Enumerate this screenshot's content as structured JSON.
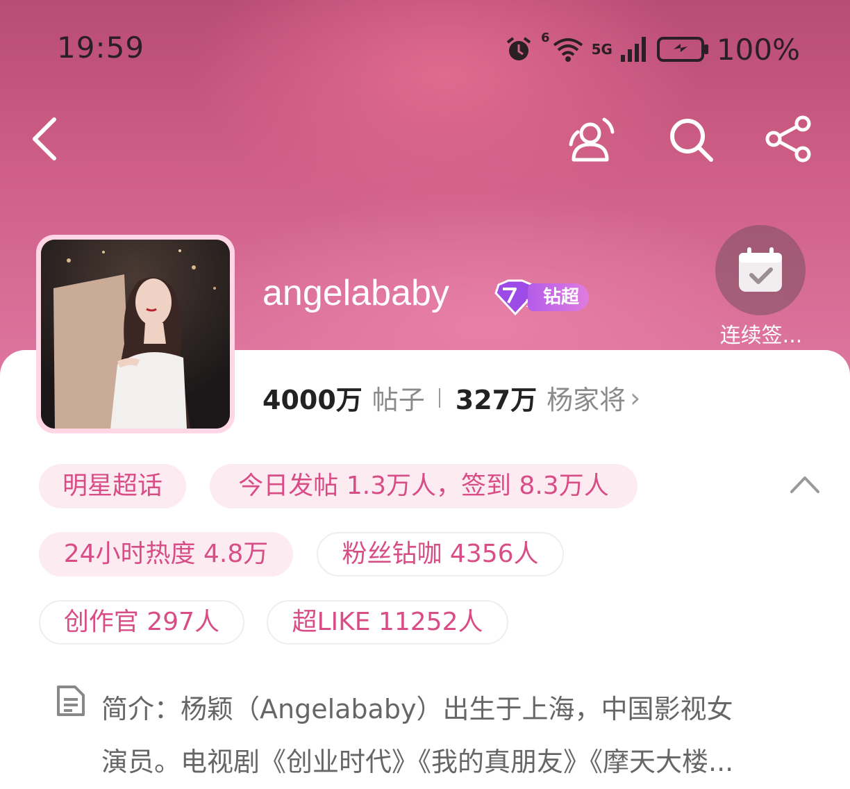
{
  "status_bar": {
    "time": "19:59",
    "network": "5G",
    "signal_label": "6",
    "battery": "100%"
  },
  "nav": {
    "back_icon": "chevron-left-icon",
    "icons": [
      "members-icon",
      "search-icon",
      "share-icon"
    ]
  },
  "profile": {
    "name": "angelababy",
    "badge_label": "钻超",
    "checkin_label": "连续签..."
  },
  "stats": {
    "posts_count": "4000万",
    "posts_label": "帖子",
    "fans_count": "327万",
    "fans_label": "杨家将",
    "chevron": "›"
  },
  "tags": [
    {
      "label": "明星超话"
    },
    {
      "label": "今日发帖 1.3万人，签到 8.3万人"
    },
    {
      "label": "24小时热度 4.8万"
    },
    {
      "label": "粉丝钻咖 4356人"
    },
    {
      "label": "创作官 297人"
    },
    {
      "label": "超LIKE 11252人"
    }
  ],
  "intro": {
    "line1": "简介：杨颖（Angelababy）出生于上海，中国影视女",
    "line2": "演员。电视剧《创业时代》《我的真朋友》《摩天大楼..."
  },
  "colors": {
    "hero_top": "#b84c73",
    "hero_bottom": "#de77a0",
    "tag_text": "#d84d86",
    "tag_fill": "#fdebf2",
    "badge": "#b35ce8"
  }
}
